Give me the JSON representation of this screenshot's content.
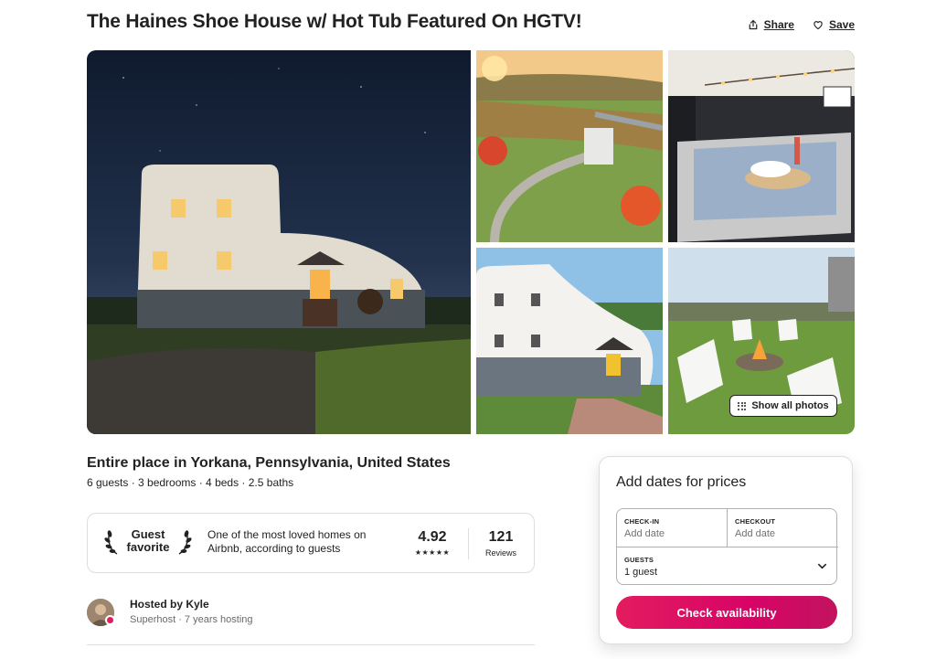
{
  "listing": {
    "title": "The Haines Shoe House w/ Hot Tub Featured On HGTV!",
    "share_label": "Share",
    "save_label": "Save",
    "show_all_photos_label": "Show all photos",
    "subtitle": "Entire place in Yorkana, Pennsylvania, United States",
    "details": "6 guests · 3 bedrooms · 4 beds · 2.5 baths"
  },
  "guest_favorite": {
    "label_line1": "Guest",
    "label_line2": "favorite",
    "description": "One of the most loved homes on Airbnb, according to guests",
    "rating": "4.92",
    "stars": "★★★★★",
    "reviews_count": "121",
    "reviews_label": "Reviews"
  },
  "host": {
    "name": "Hosted by Kyle",
    "meta": "Superhost · 7 years hosting"
  },
  "booking": {
    "title": "Add dates for prices",
    "checkin_label": "CHECK-IN",
    "checkin_value": "Add date",
    "checkout_label": "CHECKOUT",
    "checkout_value": "Add date",
    "guests_label": "GUESTS",
    "guests_value": "1 guest",
    "button_label": "Check availability"
  },
  "colors": {
    "brand": "#e31c5f",
    "text": "#222222",
    "muted": "#717171",
    "border": "#dddddd"
  },
  "icons": [
    "share-icon",
    "heart-icon",
    "grid-dots-icon",
    "laurel-icon",
    "chevron-down-icon",
    "superhost-badge-icon"
  ]
}
